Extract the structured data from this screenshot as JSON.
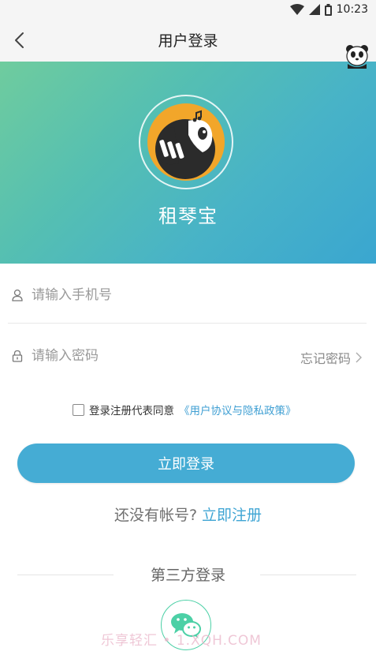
{
  "status_bar": {
    "time": "10:23"
  },
  "app_bar": {
    "title": "用户登录"
  },
  "hero": {
    "brand_name": "租琴宝"
  },
  "form": {
    "phone_placeholder": "请输入手机号",
    "password_placeholder": "请输入密码",
    "forgot_label": "忘记密码"
  },
  "agreement": {
    "text": "登录注册代表同意",
    "link": "《用户协议与隐私政策》",
    "checked": false
  },
  "login_button": "立即登录",
  "register": {
    "question": "还没有帐号?",
    "link": "立即注册"
  },
  "third_party": {
    "title": "第三方登录",
    "providers": [
      "wechat"
    ]
  },
  "watermark": "乐享轻汇 • 1.XQH.COM",
  "colors": {
    "accent": "#45acd4",
    "link": "#3f9fd3",
    "hero_start": "#6fcc9e",
    "hero_end": "#3aa6d0",
    "wechat_green": "#4cd0a6",
    "logo_orange": "#f2a62a"
  },
  "icons": {
    "back": "chevron-left-icon",
    "user": "user-icon",
    "lock": "lock-icon",
    "forgot": "chevron-right-icon",
    "wechat": "wechat-icon"
  }
}
